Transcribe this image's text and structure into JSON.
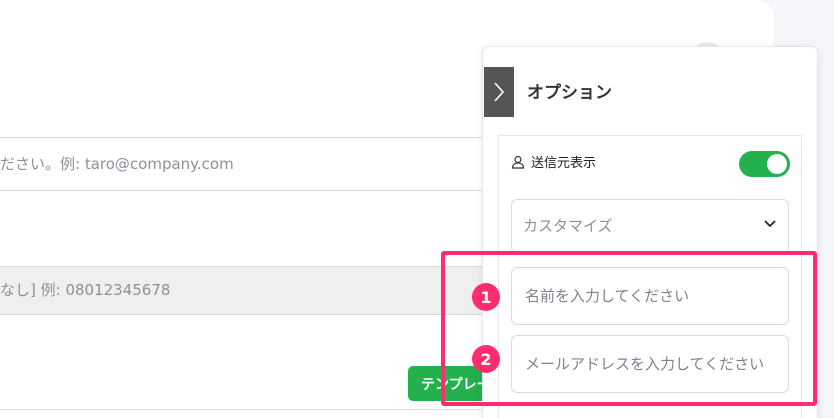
{
  "form": {
    "email_placeholder": "ださい。例: taro@company.com",
    "phone_placeholder": "なし] 例: 08012345678",
    "template_button_label": "テンプレー"
  },
  "options_panel": {
    "title": "オプション",
    "sender_display_label": "送信元表示",
    "sender_display_enabled": true,
    "customize_select_value": "カスタマイズ",
    "name_input_placeholder": "名前を入力してください",
    "email_input_placeholder": "メールアドレスを入力してください"
  },
  "annotations": {
    "callout_1": "1",
    "callout_2": "2",
    "highlight_color": "#ff2d6e"
  },
  "colors": {
    "accent_green": "#22b14c",
    "toggle_tab": "#555555"
  },
  "icons": [
    "chevron-right-icon",
    "user-icon",
    "chevron-down-icon"
  ]
}
